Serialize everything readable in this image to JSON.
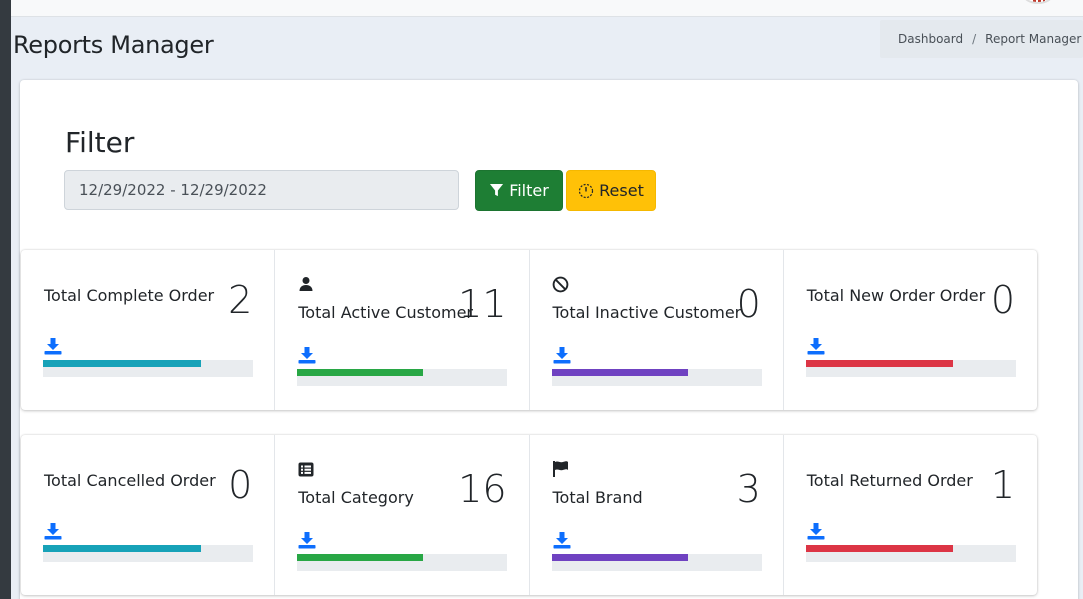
{
  "header": {
    "page_title": "Reports Manager",
    "breadcrumb": [
      "Dashboard",
      "Report Manager"
    ]
  },
  "filter": {
    "title": "Filter",
    "date_range_value": "12/29/2022 - 12/29/2022",
    "filter_button_label": "Filter",
    "reset_button_label": "Reset"
  },
  "colors": {
    "teal": "#17a2b8",
    "green": "#28a745",
    "purple": "#6f42c1",
    "red": "#dc3545",
    "filter_button": "#1e7e34",
    "reset_button": "#ffc107",
    "download_icon": "#0d6efd"
  },
  "stats_row1": [
    {
      "label": "Total Complete Order",
      "value": "2",
      "icon": null,
      "bar_color": "teal",
      "progress": 0.75
    },
    {
      "label": "Total Active Customer",
      "value": "11",
      "icon": "user-icon",
      "bar_color": "green",
      "progress": 0.6
    },
    {
      "label": "Total Inactive Customer",
      "value": "0",
      "icon": "ban-icon",
      "bar_color": "purple",
      "progress": 0.65
    },
    {
      "label": "Total New Order Order",
      "value": "0",
      "icon": null,
      "bar_color": "red",
      "progress": 0.7
    }
  ],
  "stats_row2": [
    {
      "label": "Total Cancelled Order",
      "value": "0",
      "icon": null,
      "bar_color": "teal",
      "progress": 0.75
    },
    {
      "label": "Total Category",
      "value": "16",
      "icon": "list-icon",
      "bar_color": "green",
      "progress": 0.6
    },
    {
      "label": "Total Brand",
      "value": "3",
      "icon": "flag-icon",
      "bar_color": "purple",
      "progress": 0.65
    },
    {
      "label": "Total Returned Order",
      "value": "1",
      "icon": null,
      "bar_color": "red",
      "progress": 0.7
    }
  ]
}
